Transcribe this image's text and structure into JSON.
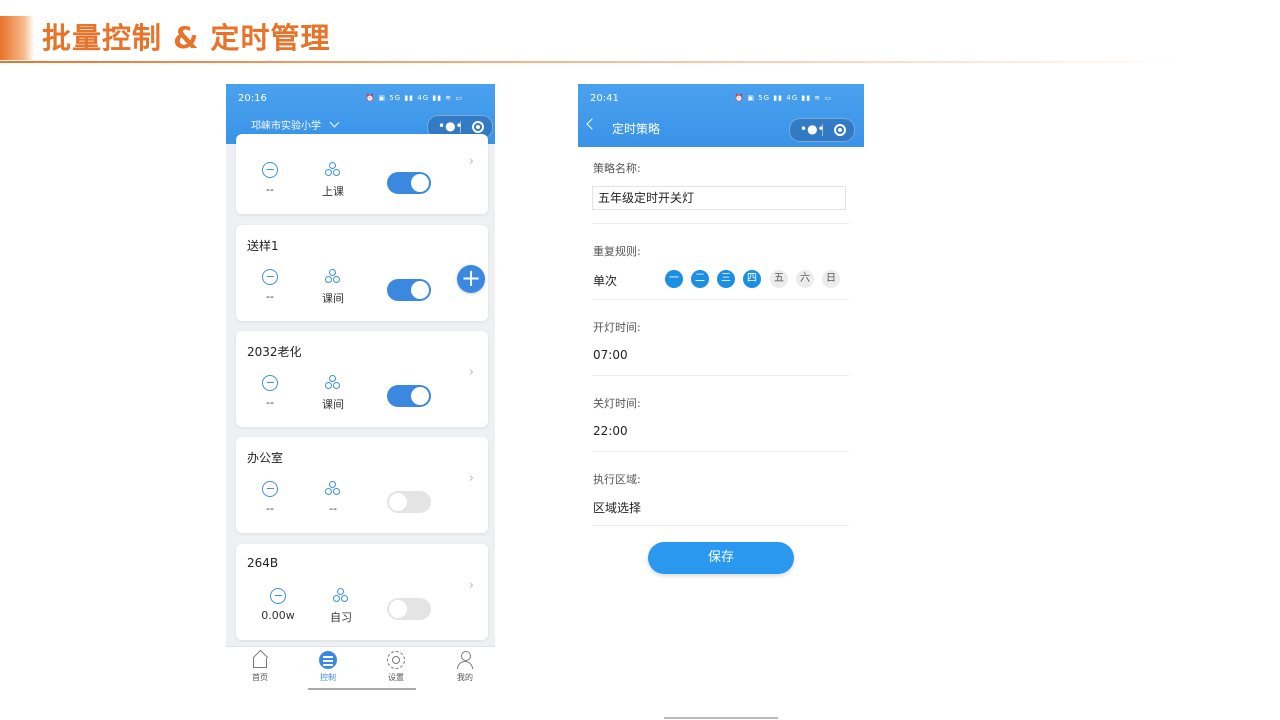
{
  "slide": {
    "title": "批量控制 & 定时管理"
  },
  "phone1": {
    "status_time": "20:16",
    "status_icons": "⏰ ▣ 5G ▮▮ 4G ▮▮ ≋ ▭",
    "school": "邛崃市实验小学",
    "capsule_dots": "•●•",
    "cards": [
      {
        "name": "",
        "power": "--",
        "scene": "上课",
        "on": true
      },
      {
        "name": "送样1",
        "power": "--",
        "scene": "课间",
        "on": true
      },
      {
        "name": "2032老化",
        "power": "--",
        "scene": "课间",
        "on": true
      },
      {
        "name": "办公室",
        "power": "--",
        "scene": "--",
        "on": false
      },
      {
        "name": "264B",
        "power": "0.00w",
        "scene": "自习",
        "on": false
      }
    ],
    "arrow": "›",
    "fab": "+",
    "tabs": [
      {
        "label": "首页",
        "icon": "home-icon"
      },
      {
        "label": "控制",
        "icon": "control-icon"
      },
      {
        "label": "设置",
        "icon": "gear-icon"
      },
      {
        "label": "我的",
        "icon": "user-icon"
      }
    ],
    "active_tab": "控制"
  },
  "phone2": {
    "status_time": "20:41",
    "status_icons": "⏰ ▣ 5G ▮▮ 4G ▮▮ ≋ ▭",
    "capsule_dots": "•●•",
    "nav_title": "定时策略",
    "name_label": "策略名称:",
    "name_value": "五年级定时开关灯",
    "repeat_label": "重复规则:",
    "repeat_mode": "单次",
    "days": [
      {
        "label": "一",
        "selected": true
      },
      {
        "label": "二",
        "selected": true
      },
      {
        "label": "三",
        "selected": true
      },
      {
        "label": "四",
        "selected": true
      },
      {
        "label": "五",
        "selected": false
      },
      {
        "label": "六",
        "selected": false
      },
      {
        "label": "日",
        "selected": false
      }
    ],
    "on_label": "开灯时间:",
    "on_time": "07:00",
    "off_label": "关灯时间:",
    "off_time": "22:00",
    "area_label": "执行区域:",
    "area_value": "区域选择",
    "save": "保存"
  },
  "colors": {
    "accent": "#e8732a",
    "primary": "#3b88e0",
    "header": "#4aa1ee"
  }
}
